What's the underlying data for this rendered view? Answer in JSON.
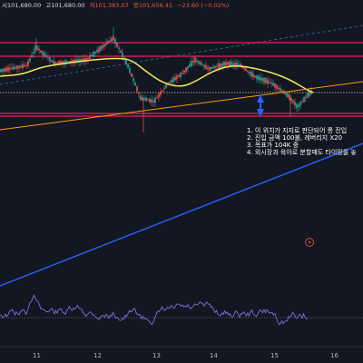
{
  "header": {
    "ohlc": [
      {
        "key": "시",
        "value": "101,680.00",
        "color": "#d9d9d9"
      },
      {
        "key": "고",
        "value": "101,680.00",
        "color": "#d9d9d9"
      },
      {
        "key": "저",
        "value": "101,383.07",
        "color": "#ef5350"
      },
      {
        "key": "종",
        "value": "101,656.41",
        "color": "#ef5350"
      },
      {
        "key": "",
        "value": "−23.60 (−0.02%)",
        "color": "#ef5350"
      }
    ]
  },
  "notes": [
    "1. 이 위치가 지지로 판단되어 롱 진입",
    "2. 진입 금액 100불, 레버리지 X20",
    "3. 목표가 104K 중",
    "4. 외시장과 육아로 분할매도 타이밍을 놓"
  ],
  "colors": {
    "background": "#131722",
    "candle_up": "#26a69a",
    "candle_down": "#ef5350",
    "moving_average": "#f2e65a",
    "resistance_zone": "#e91e63",
    "orange_trendline": "#ff9800",
    "blue_trendline": "#2962ff",
    "dashed_channel": "#3d6fa8",
    "support_arrow": "#2962ff",
    "oscillator": "#7e6fd6"
  },
  "icons": {
    "lightning": "lightning-icon",
    "arrow": "up-down-arrow-icon"
  },
  "chart_data": [
    {
      "type": "candlestick",
      "x_axis_labels": [
        "11",
        "12",
        "13",
        "14",
        "15",
        "16"
      ],
      "overlays": [
        "moving average",
        "horizontal resistance lines",
        "horizontal support lines",
        "dotted level line",
        "ascending trendlines",
        "dashed channel line"
      ]
    },
    {
      "type": "line",
      "name": "",
      "x_axis_labels": [
        "11",
        "12",
        "13",
        "14",
        "15",
        "16"
      ],
      "overlays": [
        "horizontal reference line"
      ]
    }
  ]
}
